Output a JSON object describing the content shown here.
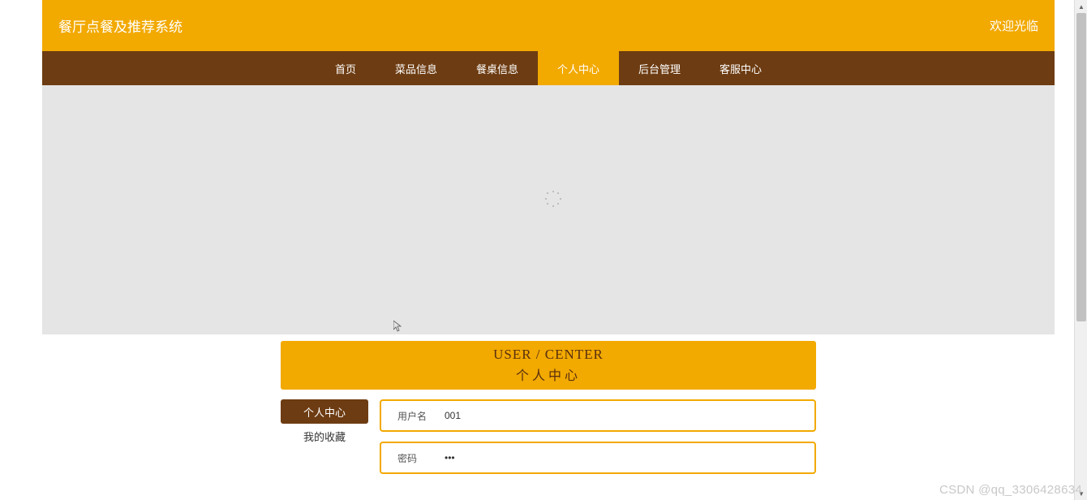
{
  "header": {
    "title": "餐厅点餐及推荐系统",
    "welcome": "欢迎光临"
  },
  "nav": {
    "items": [
      {
        "label": "首页",
        "active": false
      },
      {
        "label": "菜品信息",
        "active": false
      },
      {
        "label": "餐桌信息",
        "active": false
      },
      {
        "label": "个人中心",
        "active": true
      },
      {
        "label": "后台管理",
        "active": false
      },
      {
        "label": "客服中心",
        "active": false
      }
    ]
  },
  "user_center": {
    "header_en": "USER / CENTER",
    "header_cn": "个人中心",
    "sidebar": [
      {
        "label": "个人中心",
        "active": true
      },
      {
        "label": "我的收藏",
        "active": false
      }
    ],
    "form": {
      "rows": [
        {
          "label": "用户名",
          "value": "001",
          "type": "text"
        },
        {
          "label": "密码",
          "value": "***",
          "type": "password"
        }
      ]
    }
  },
  "watermark": "CSDN @qq_3306428634"
}
